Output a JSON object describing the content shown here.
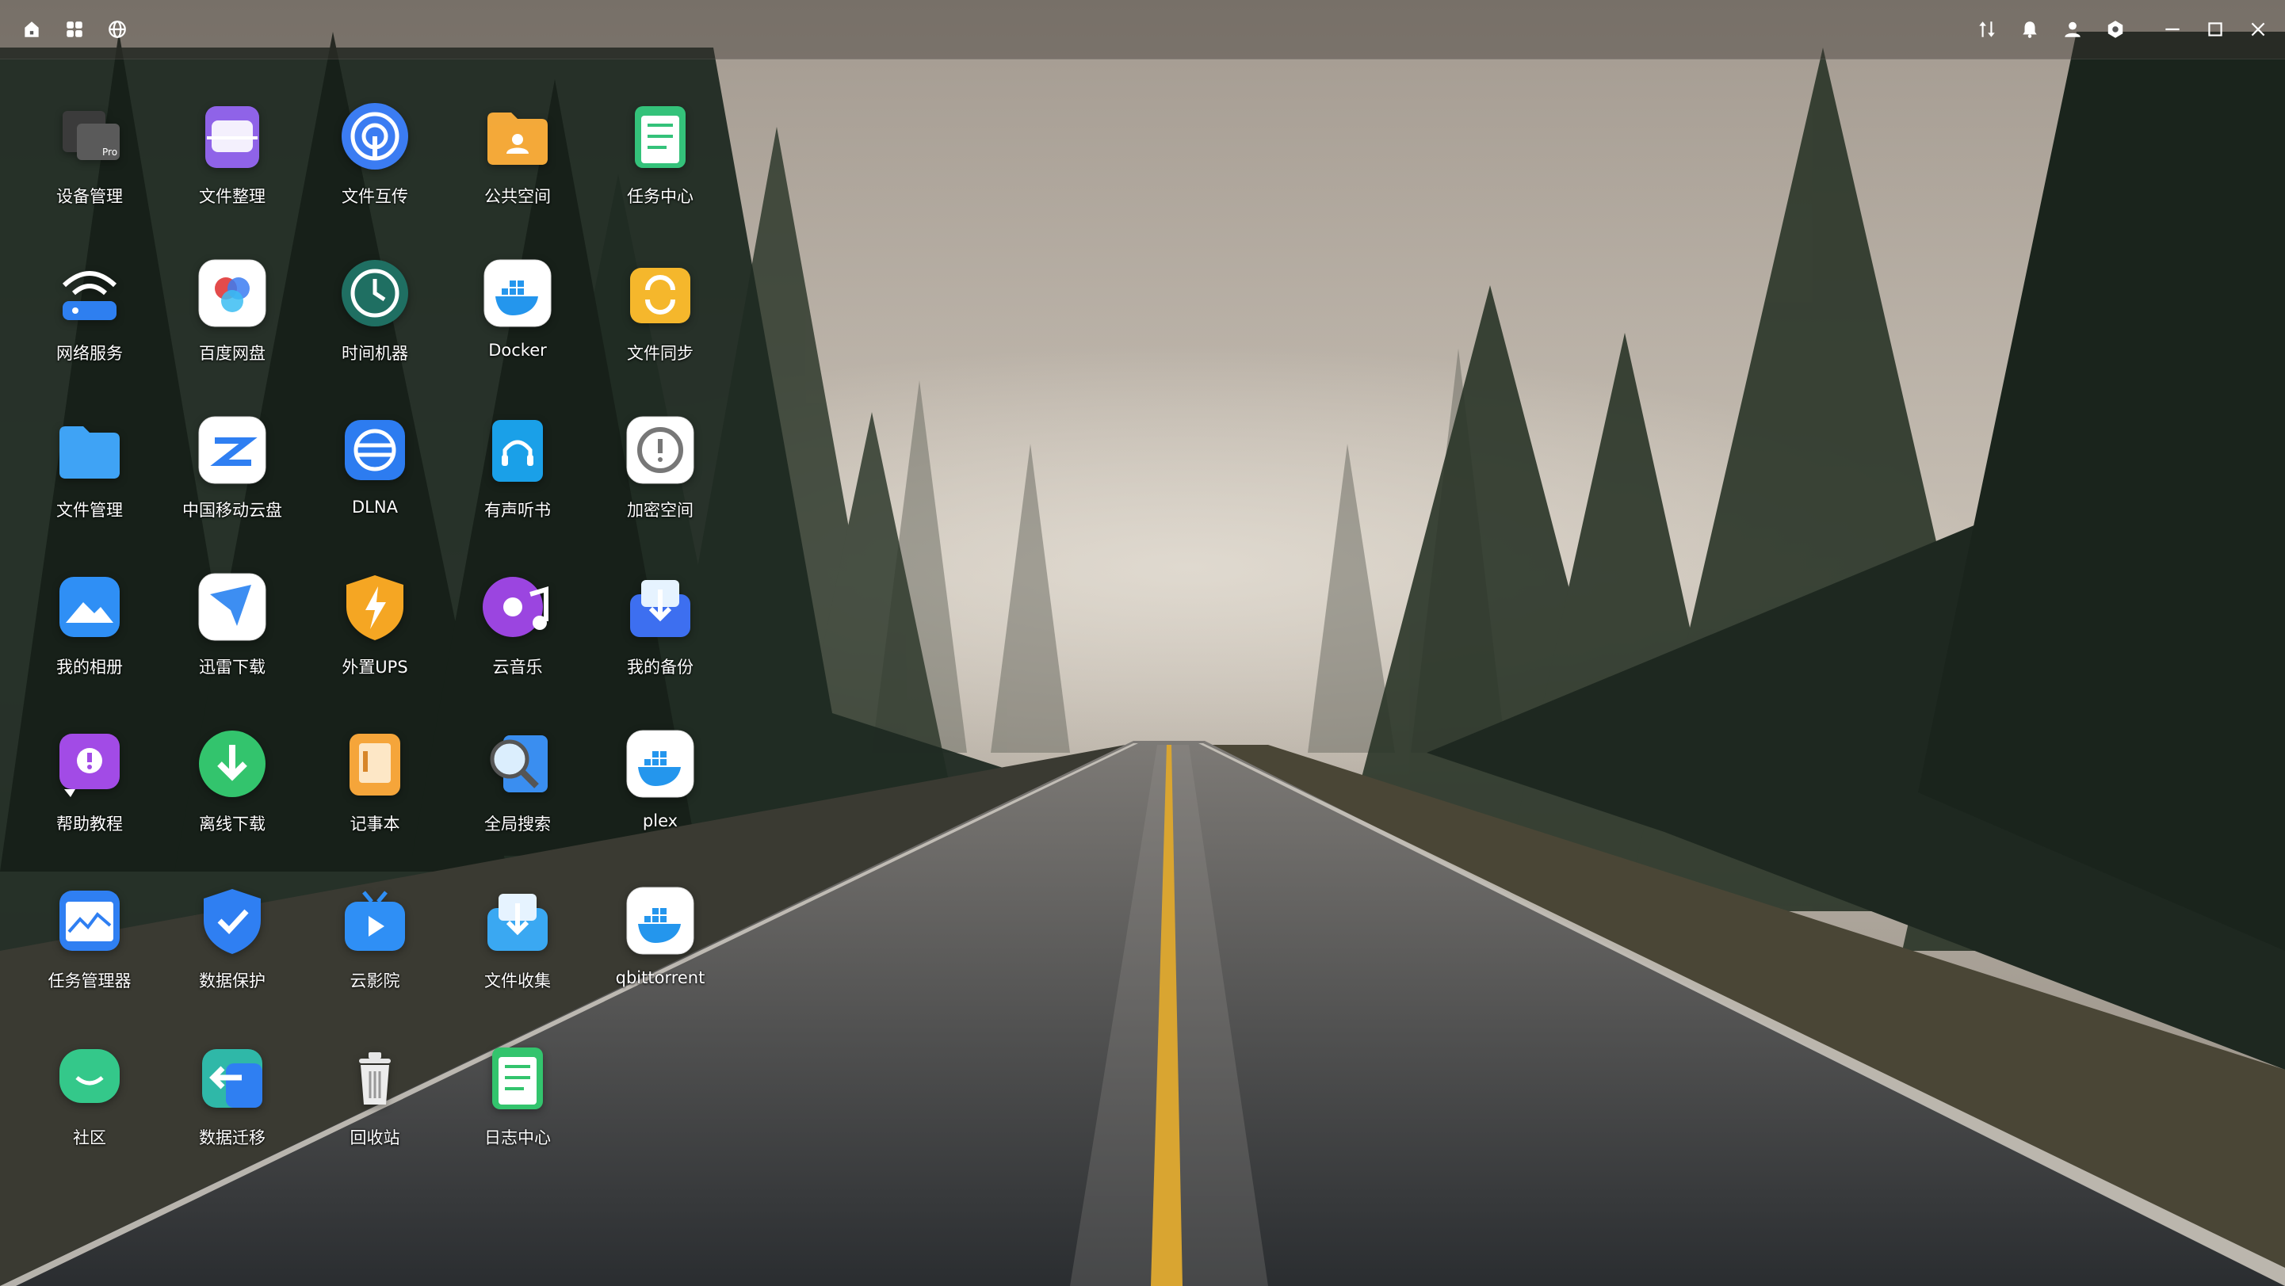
{
  "topbar": {
    "left_icons": [
      "home-icon",
      "apps-grid-icon",
      "globe-icon"
    ],
    "right_icons": [
      "transfer-icon",
      "bell-icon",
      "user-icon",
      "settings-icon",
      "minimize-icon",
      "maximize-icon",
      "close-icon"
    ]
  },
  "apps": [
    {
      "label": "设备管理",
      "icon": "device-manager-icon",
      "color": "#4a4a4a"
    },
    {
      "label": "文件整理",
      "icon": "file-organize-icon",
      "color": "#8f63e8"
    },
    {
      "label": "文件互传",
      "icon": "file-transfer-icon",
      "color": "#3b7cf2"
    },
    {
      "label": "公共空间",
      "icon": "public-space-icon",
      "color": "#f3a93a"
    },
    {
      "label": "任务中心",
      "icon": "task-center-icon",
      "color": "#34c27a"
    },
    {
      "label": "网络服务",
      "icon": "network-service-icon",
      "color": "#2e7ff0"
    },
    {
      "label": "百度网盘",
      "icon": "baidu-netdisk-icon",
      "color": "#ffffff"
    },
    {
      "label": "时间机器",
      "icon": "time-machine-icon",
      "color": "#1f6f62"
    },
    {
      "label": "Docker",
      "icon": "docker-icon",
      "color": "#ffffff"
    },
    {
      "label": "文件同步",
      "icon": "file-sync-icon",
      "color": "#f5b72c"
    },
    {
      "label": "文件管理",
      "icon": "file-manager-icon",
      "color": "#3fa3f5"
    },
    {
      "label": "中国移动云盘",
      "icon": "china-mobile-cloud-icon",
      "color": "#ffffff"
    },
    {
      "label": "DLNA",
      "icon": "dlna-icon",
      "color": "#2d7cf0"
    },
    {
      "label": "有声听书",
      "icon": "audiobook-icon",
      "color": "#1aa0e8"
    },
    {
      "label": "加密空间",
      "icon": "encrypted-space-icon",
      "color": "#ffffff"
    },
    {
      "label": "我的相册",
      "icon": "photo-album-icon",
      "color": "#2f8ff5"
    },
    {
      "label": "迅雷下载",
      "icon": "thunder-download-icon",
      "color": "#ffffff"
    },
    {
      "label": "外置UPS",
      "icon": "external-ups-icon",
      "color": "#f5a623"
    },
    {
      "label": "云音乐",
      "icon": "cloud-music-icon",
      "color": "#9b45e0"
    },
    {
      "label": "我的备份",
      "icon": "my-backup-icon",
      "color": "#3d6ff0"
    },
    {
      "label": "帮助教程",
      "icon": "help-tutorial-icon",
      "color": "#a24be6"
    },
    {
      "label": "离线下载",
      "icon": "offline-download-icon",
      "color": "#33c46d"
    },
    {
      "label": "记事本",
      "icon": "notepad-icon",
      "color": "#f5a53a"
    },
    {
      "label": "全局搜索",
      "icon": "global-search-icon",
      "color": "#3a8ef0"
    },
    {
      "label": "plex",
      "icon": "docker-icon",
      "color": "#ffffff"
    },
    {
      "label": "任务管理器",
      "icon": "task-manager-icon",
      "color": "#2f7ff2"
    },
    {
      "label": "数据保护",
      "icon": "data-protection-icon",
      "color": "#2f7ff2"
    },
    {
      "label": "云影院",
      "icon": "cloud-cinema-icon",
      "color": "#2f8ff5"
    },
    {
      "label": "文件收集",
      "icon": "file-collect-icon",
      "color": "#3aa8f2"
    },
    {
      "label": "qbittorrent",
      "icon": "docker-icon",
      "color": "#ffffff"
    },
    {
      "label": "社区",
      "icon": "community-icon",
      "color": "#34c88a"
    },
    {
      "label": "数据迁移",
      "icon": "data-migration-icon",
      "color": "#2fb8a8"
    },
    {
      "label": "回收站",
      "icon": "recycle-bin-icon",
      "color": "#e8e8e8"
    },
    {
      "label": "日志中心",
      "icon": "log-center-icon",
      "color": "#33c46d"
    }
  ]
}
